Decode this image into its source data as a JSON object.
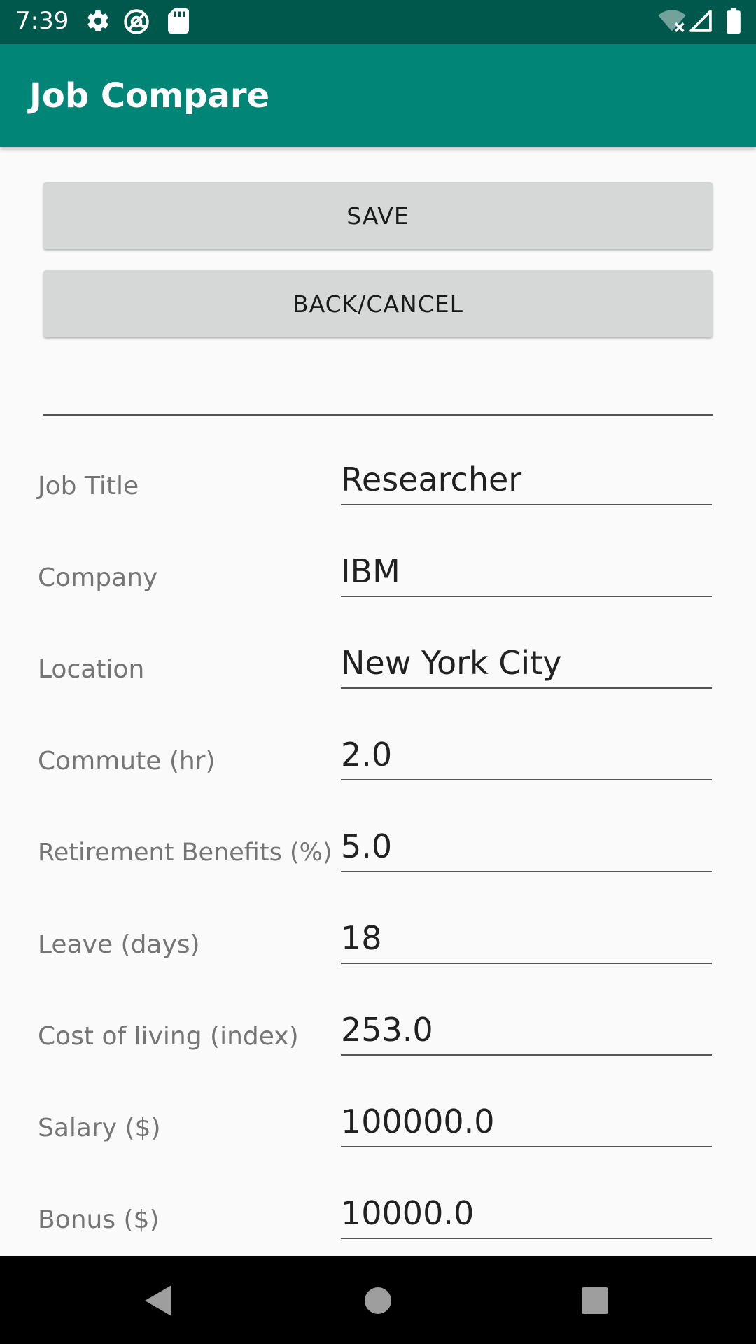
{
  "status_bar": {
    "time": "7:39",
    "icons_left": [
      "settings-icon",
      "at-sign-icon",
      "sd-card-icon"
    ],
    "icons_right": [
      "wifi-off-icon",
      "signal-icon",
      "battery-icon"
    ],
    "background": "#00574b"
  },
  "app_bar": {
    "title": "Job Compare",
    "background": "#008577"
  },
  "buttons": {
    "save_label": "SAVE",
    "back_label": "BACK/CANCEL"
  },
  "form": {
    "fields": [
      {
        "label": "Job Title",
        "value": "Researcher"
      },
      {
        "label": "Company",
        "value": "IBM"
      },
      {
        "label": "Location",
        "value": "New York City"
      },
      {
        "label": "Commute (hr)",
        "value": "2.0"
      },
      {
        "label": "Retirement Benefits (%)",
        "value": "5.0"
      },
      {
        "label": "Leave (days)",
        "value": "18"
      },
      {
        "label": "Cost of living (index)",
        "value": "253.0"
      },
      {
        "label": "Salary ($)",
        "value": "100000.0"
      },
      {
        "label": "Bonus ($)",
        "value": "10000.0"
      }
    ]
  },
  "nav_bar": {
    "icons": [
      "back-triangle-icon",
      "home-circle-icon",
      "recents-square-icon"
    ]
  }
}
